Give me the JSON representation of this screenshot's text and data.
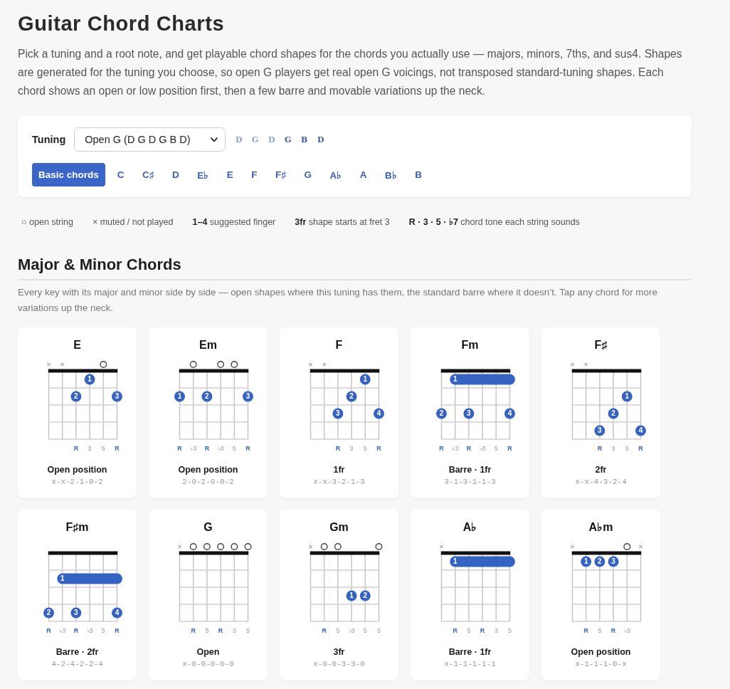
{
  "title": "Guitar Chord Charts",
  "intro": "Pick a tuning and a root note, and get playable chord shapes for the chords you actually use — majors, minors, 7ths, and sus4. Shapes are generated for the tuning you choose, so open G players get real open G voicings, not transposed standard-tuning shapes. Each chord shows an open or low position first, then a few barre and movable variations up the neck.",
  "controls": {
    "tuning": {
      "label": "Tuning",
      "value": "Open G (D G D G B D)",
      "strings": [
        {
          "note": "D",
          "color": "#8ea3cc"
        },
        {
          "note": "G",
          "color": "#8ea3cc"
        },
        {
          "note": "D",
          "color": "#8ea3cc"
        },
        {
          "note": "G",
          "color": "#3b5aa6"
        },
        {
          "note": "B",
          "color": "#3b5aa6"
        },
        {
          "note": "D",
          "color": "#3b5aa6"
        }
      ]
    },
    "keys": [
      {
        "label": "Basic chords",
        "selected": true
      },
      {
        "label": "C",
        "selected": false
      },
      {
        "label": "C♯",
        "selected": false
      },
      {
        "label": "D",
        "selected": false
      },
      {
        "label": "E♭",
        "selected": false
      },
      {
        "label": "E",
        "selected": false
      },
      {
        "label": "F",
        "selected": false
      },
      {
        "label": "F♯",
        "selected": false
      },
      {
        "label": "G",
        "selected": false
      },
      {
        "label": "A♭",
        "selected": false
      },
      {
        "label": "A",
        "selected": false
      },
      {
        "label": "B♭",
        "selected": false
      },
      {
        "label": "B",
        "selected": false
      }
    ]
  },
  "legend": [
    "○ open string",
    "× muted / not played",
    "**1–4** suggested finger",
    "**3fr** shape starts at fret 3",
    "**R · 3 · 5 · ♭7** chord tone each string sounds"
  ],
  "section": {
    "title": "Major & Minor Chords",
    "description": "Every key with its major and minor side by side — open shapes where this tuning has them, the standard barre where it doesn’t. Tap any chord for more variations up the neck."
  },
  "chords": [
    {
      "name": "E",
      "strings": [
        {
          "kind": "muted"
        },
        {
          "kind": "muted"
        },
        {
          "kind": "fretted",
          "tone": "R",
          "root": true
        },
        {
          "kind": "fretted",
          "tone": "3",
          "root": false
        },
        {
          "kind": "open",
          "tone": "5",
          "root": false
        },
        {
          "kind": "fretted",
          "tone": "R",
          "root": true
        }
      ],
      "frets": [
        {
          "cells": [
            {
              "kind": "empty"
            },
            {
              "kind": "empty"
            },
            {
              "kind": "empty"
            },
            {
              "kind": "dot",
              "finger": "1"
            },
            {
              "kind": "empty"
            },
            {
              "kind": "empty"
            }
          ]
        },
        {
          "cells": [
            {
              "kind": "empty"
            },
            {
              "kind": "empty"
            },
            {
              "kind": "dot",
              "finger": "2"
            },
            {
              "kind": "empty"
            },
            {
              "kind": "empty"
            },
            {
              "kind": "dot",
              "finger": "3"
            }
          ]
        },
        {
          "cells": [
            {
              "kind": "empty"
            },
            {
              "kind": "empty"
            },
            {
              "kind": "empty"
            },
            {
              "kind": "empty"
            },
            {
              "kind": "empty"
            },
            {
              "kind": "empty"
            }
          ]
        },
        {
          "cells": [
            {
              "kind": "empty"
            },
            {
              "kind": "empty"
            },
            {
              "kind": "empty"
            },
            {
              "kind": "empty"
            },
            {
              "kind": "empty"
            },
            {
              "kind": "empty"
            }
          ]
        }
      ],
      "position": "Open position",
      "fingering": "x-x-2-1-0-2"
    },
    {
      "name": "Em",
      "strings": [
        {
          "kind": "fretted",
          "tone": "R",
          "root": true
        },
        {
          "kind": "open",
          "tone": "♭3",
          "root": false
        },
        {
          "kind": "fretted",
          "tone": "R",
          "root": true
        },
        {
          "kind": "open",
          "tone": "♭3",
          "root": false
        },
        {
          "kind": "open",
          "tone": "5",
          "root": false
        },
        {
          "kind": "fretted",
          "tone": "R",
          "root": true
        }
      ],
      "frets": [
        {
          "cells": [
            {
              "kind": "empty"
            },
            {
              "kind": "empty"
            },
            {
              "kind": "empty"
            },
            {
              "kind": "empty"
            },
            {
              "kind": "empty"
            },
            {
              "kind": "empty"
            }
          ]
        },
        {
          "cells": [
            {
              "kind": "dot",
              "finger": "1"
            },
            {
              "kind": "empty"
            },
            {
              "kind": "dot",
              "finger": "2"
            },
            {
              "kind": "empty"
            },
            {
              "kind": "empty"
            },
            {
              "kind": "dot",
              "finger": "3"
            }
          ]
        },
        {
          "cells": [
            {
              "kind": "empty"
            },
            {
              "kind": "empty"
            },
            {
              "kind": "empty"
            },
            {
              "kind": "empty"
            },
            {
              "kind": "empty"
            },
            {
              "kind": "empty"
            }
          ]
        },
        {
          "cells": [
            {
              "kind": "empty"
            },
            {
              "kind": "empty"
            },
            {
              "kind": "empty"
            },
            {
              "kind": "empty"
            },
            {
              "kind": "empty"
            },
            {
              "kind": "empty"
            }
          ]
        }
      ],
      "position": "Open position",
      "fingering": "2-0-2-0-0-2"
    },
    {
      "name": "F",
      "strings": [
        {
          "kind": "muted"
        },
        {
          "kind": "muted"
        },
        {
          "kind": "fretted",
          "tone": "R",
          "root": true
        },
        {
          "kind": "fretted",
          "tone": "3",
          "root": false
        },
        {
          "kind": "fretted",
          "tone": "5",
          "root": false
        },
        {
          "kind": "fretted",
          "tone": "R",
          "root": true
        }
      ],
      "frets": [
        {
          "cells": [
            {
              "kind": "empty"
            },
            {
              "kind": "empty"
            },
            {
              "kind": "empty"
            },
            {
              "kind": "empty"
            },
            {
              "kind": "dot",
              "finger": "1"
            },
            {
              "kind": "empty"
            }
          ]
        },
        {
          "cells": [
            {
              "kind": "empty"
            },
            {
              "kind": "empty"
            },
            {
              "kind": "empty"
            },
            {
              "kind": "dot",
              "finger": "2"
            },
            {
              "kind": "empty"
            },
            {
              "kind": "empty"
            }
          ]
        },
        {
          "cells": [
            {
              "kind": "empty"
            },
            {
              "kind": "empty"
            },
            {
              "kind": "dot",
              "finger": "3"
            },
            {
              "kind": "empty"
            },
            {
              "kind": "empty"
            },
            {
              "kind": "dot",
              "finger": "4"
            }
          ]
        },
        {
          "cells": [
            {
              "kind": "empty"
            },
            {
              "kind": "empty"
            },
            {
              "kind": "empty"
            },
            {
              "kind": "empty"
            },
            {
              "kind": "empty"
            },
            {
              "kind": "empty"
            }
          ]
        }
      ],
      "position": "1fr",
      "fingering": "x-x-3-2-1-3"
    },
    {
      "name": "Fm",
      "strings": [
        {
          "kind": "fretted",
          "tone": "R",
          "root": true
        },
        {
          "kind": "fretted",
          "tone": "♭3",
          "root": false
        },
        {
          "kind": "fretted",
          "tone": "R",
          "root": true
        },
        {
          "kind": "fretted",
          "tone": "♭3",
          "root": false
        },
        {
          "kind": "fretted",
          "tone": "5",
          "root": false
        },
        {
          "kind": "fretted",
          "tone": "R",
          "root": true
        }
      ],
      "frets": [
        {
          "cells": [
            {
              "kind": "empty"
            },
            {
              "kind": "barre",
              "finger": "1"
            },
            {
              "kind": "barre"
            },
            {
              "kind": "barre"
            },
            {
              "kind": "barre"
            },
            {
              "kind": "barre"
            }
          ]
        },
        {
          "cells": [
            {
              "kind": "empty"
            },
            {
              "kind": "empty"
            },
            {
              "kind": "empty"
            },
            {
              "kind": "empty"
            },
            {
              "kind": "empty"
            },
            {
              "kind": "empty"
            }
          ]
        },
        {
          "cells": [
            {
              "kind": "dot",
              "finger": "2"
            },
            {
              "kind": "empty"
            },
            {
              "kind": "dot",
              "finger": "3"
            },
            {
              "kind": "empty"
            },
            {
              "kind": "empty"
            },
            {
              "kind": "dot",
              "finger": "4"
            }
          ]
        },
        {
          "cells": [
            {
              "kind": "empty"
            },
            {
              "kind": "empty"
            },
            {
              "kind": "empty"
            },
            {
              "kind": "empty"
            },
            {
              "kind": "empty"
            },
            {
              "kind": "empty"
            }
          ]
        }
      ],
      "position": "Barre · 1fr",
      "fingering": "3-1-3-1-1-3"
    },
    {
      "name": "F♯",
      "strings": [
        {
          "kind": "muted"
        },
        {
          "kind": "muted"
        },
        {
          "kind": "fretted",
          "tone": "R",
          "root": true
        },
        {
          "kind": "fretted",
          "tone": "3",
          "root": false
        },
        {
          "kind": "fretted",
          "tone": "5",
          "root": false
        },
        {
          "kind": "fretted",
          "tone": "R",
          "root": true
        }
      ],
      "frets": [
        {
          "cells": [
            {
              "kind": "empty"
            },
            {
              "kind": "empty"
            },
            {
              "kind": "empty"
            },
            {
              "kind": "empty"
            },
            {
              "kind": "empty"
            },
            {
              "kind": "empty"
            }
          ]
        },
        {
          "cells": [
            {
              "kind": "empty"
            },
            {
              "kind": "empty"
            },
            {
              "kind": "empty"
            },
            {
              "kind": "empty"
            },
            {
              "kind": "dot",
              "finger": "1"
            },
            {
              "kind": "empty"
            }
          ]
        },
        {
          "cells": [
            {
              "kind": "empty"
            },
            {
              "kind": "empty"
            },
            {
              "kind": "empty"
            },
            {
              "kind": "dot",
              "finger": "2"
            },
            {
              "kind": "empty"
            },
            {
              "kind": "empty"
            }
          ]
        },
        {
          "cells": [
            {
              "kind": "empty"
            },
            {
              "kind": "empty"
            },
            {
              "kind": "dot",
              "finger": "3"
            },
            {
              "kind": "empty"
            },
            {
              "kind": "empty"
            },
            {
              "kind": "dot",
              "finger": "4"
            }
          ]
        }
      ],
      "position": "2fr",
      "fingering": "x-x-4-3-2-4"
    },
    {
      "name": "F♯m",
      "strings": [
        {
          "kind": "fretted",
          "tone": "R",
          "root": true
        },
        {
          "kind": "fretted",
          "tone": "♭3",
          "root": false
        },
        {
          "kind": "fretted",
          "tone": "R",
          "root": true
        },
        {
          "kind": "fretted",
          "tone": "♭3",
          "root": false
        },
        {
          "kind": "fretted",
          "tone": "5",
          "root": false
        },
        {
          "kind": "fretted",
          "tone": "R",
          "root": true
        }
      ],
      "frets": [
        {
          "cells": [
            {
              "kind": "empty"
            },
            {
              "kind": "empty"
            },
            {
              "kind": "empty"
            },
            {
              "kind": "empty"
            },
            {
              "kind": "empty"
            },
            {
              "kind": "empty"
            }
          ]
        },
        {
          "cells": [
            {
              "kind": "empty"
            },
            {
              "kind": "barre",
              "finger": "1"
            },
            {
              "kind": "barre"
            },
            {
              "kind": "barre"
            },
            {
              "kind": "barre"
            },
            {
              "kind": "barre"
            }
          ]
        },
        {
          "cells": [
            {
              "kind": "empty"
            },
            {
              "kind": "empty"
            },
            {
              "kind": "empty"
            },
            {
              "kind": "empty"
            },
            {
              "kind": "empty"
            },
            {
              "kind": "empty"
            }
          ]
        },
        {
          "cells": [
            {
              "kind": "dot",
              "finger": "2"
            },
            {
              "kind": "empty"
            },
            {
              "kind": "dot",
              "finger": "3"
            },
            {
              "kind": "empty"
            },
            {
              "kind": "empty"
            },
            {
              "kind": "dot",
              "finger": "4"
            }
          ]
        }
      ],
      "position": "Barre · 2fr",
      "fingering": "4-2-4-2-2-4"
    },
    {
      "name": "G",
      "strings": [
        {
          "kind": "muted"
        },
        {
          "kind": "open",
          "tone": "R",
          "root": true
        },
        {
          "kind": "open",
          "tone": "5",
          "root": false
        },
        {
          "kind": "open",
          "tone": "R",
          "root": true
        },
        {
          "kind": "open",
          "tone": "3",
          "root": false
        },
        {
          "kind": "open",
          "tone": "5",
          "root": false
        }
      ],
      "frets": [
        {
          "cells": [
            {
              "kind": "empty"
            },
            {
              "kind": "empty"
            },
            {
              "kind": "empty"
            },
            {
              "kind": "empty"
            },
            {
              "kind": "empty"
            },
            {
              "kind": "empty"
            }
          ]
        },
        {
          "cells": [
            {
              "kind": "empty"
            },
            {
              "kind": "empty"
            },
            {
              "kind": "empty"
            },
            {
              "kind": "empty"
            },
            {
              "kind": "empty"
            },
            {
              "kind": "empty"
            }
          ]
        },
        {
          "cells": [
            {
              "kind": "empty"
            },
            {
              "kind": "empty"
            },
            {
              "kind": "empty"
            },
            {
              "kind": "empty"
            },
            {
              "kind": "empty"
            },
            {
              "kind": "empty"
            }
          ]
        },
        {
          "cells": [
            {
              "kind": "empty"
            },
            {
              "kind": "empty"
            },
            {
              "kind": "empty"
            },
            {
              "kind": "empty"
            },
            {
              "kind": "empty"
            },
            {
              "kind": "empty"
            }
          ]
        }
      ],
      "position": "Open",
      "fingering": "x-0-0-0-0-0"
    },
    {
      "name": "Gm",
      "strings": [
        {
          "kind": "muted"
        },
        {
          "kind": "open",
          "tone": "R",
          "root": true
        },
        {
          "kind": "open",
          "tone": "5",
          "root": false
        },
        {
          "kind": "fretted",
          "tone": "♭3",
          "root": false
        },
        {
          "kind": "fretted",
          "tone": "5",
          "root": false
        },
        {
          "kind": "open",
          "tone": "5",
          "root": false
        }
      ],
      "frets": [
        {
          "cells": [
            {
              "kind": "empty"
            },
            {
              "kind": "empty"
            },
            {
              "kind": "empty"
            },
            {
              "kind": "empty"
            },
            {
              "kind": "empty"
            },
            {
              "kind": "empty"
            }
          ]
        },
        {
          "cells": [
            {
              "kind": "empty"
            },
            {
              "kind": "empty"
            },
            {
              "kind": "empty"
            },
            {
              "kind": "empty"
            },
            {
              "kind": "empty"
            },
            {
              "kind": "empty"
            }
          ]
        },
        {
          "cells": [
            {
              "kind": "empty"
            },
            {
              "kind": "empty"
            },
            {
              "kind": "empty"
            },
            {
              "kind": "dot",
              "finger": "1"
            },
            {
              "kind": "dot",
              "finger": "2"
            },
            {
              "kind": "empty"
            }
          ]
        },
        {
          "cells": [
            {
              "kind": "empty"
            },
            {
              "kind": "empty"
            },
            {
              "kind": "empty"
            },
            {
              "kind": "empty"
            },
            {
              "kind": "empty"
            },
            {
              "kind": "empty"
            }
          ]
        }
      ],
      "position": "3fr",
      "fingering": "x-0-0-3-3-0"
    },
    {
      "name": "A♭",
      "strings": [
        {
          "kind": "muted"
        },
        {
          "kind": "fretted",
          "tone": "R",
          "root": true
        },
        {
          "kind": "fretted",
          "tone": "5",
          "root": false
        },
        {
          "kind": "fretted",
          "tone": "R",
          "root": true
        },
        {
          "kind": "fretted",
          "tone": "3",
          "root": false
        },
        {
          "kind": "fretted",
          "tone": "5",
          "root": false
        }
      ],
      "frets": [
        {
          "cells": [
            {
              "kind": "empty"
            },
            {
              "kind": "barre",
              "finger": "1"
            },
            {
              "kind": "barre"
            },
            {
              "kind": "barre"
            },
            {
              "kind": "barre"
            },
            {
              "kind": "barre"
            }
          ]
        },
        {
          "cells": [
            {
              "kind": "empty"
            },
            {
              "kind": "empty"
            },
            {
              "kind": "empty"
            },
            {
              "kind": "empty"
            },
            {
              "kind": "empty"
            },
            {
              "kind": "empty"
            }
          ]
        },
        {
          "cells": [
            {
              "kind": "empty"
            },
            {
              "kind": "empty"
            },
            {
              "kind": "empty"
            },
            {
              "kind": "empty"
            },
            {
              "kind": "empty"
            },
            {
              "kind": "empty"
            }
          ]
        },
        {
          "cells": [
            {
              "kind": "empty"
            },
            {
              "kind": "empty"
            },
            {
              "kind": "empty"
            },
            {
              "kind": "empty"
            },
            {
              "kind": "empty"
            },
            {
              "kind": "empty"
            }
          ]
        }
      ],
      "position": "Barre · 1fr",
      "fingering": "x-1-1-1-1-1"
    },
    {
      "name": "A♭m",
      "strings": [
        {
          "kind": "muted"
        },
        {
          "kind": "fretted",
          "tone": "R",
          "root": true
        },
        {
          "kind": "fretted",
          "tone": "5",
          "root": false
        },
        {
          "kind": "fretted",
          "tone": "R",
          "root": true
        },
        {
          "kind": "open",
          "tone": "♭3",
          "root": false
        },
        {
          "kind": "muted"
        }
      ],
      "frets": [
        {
          "cells": [
            {
              "kind": "empty"
            },
            {
              "kind": "dot",
              "finger": "1"
            },
            {
              "kind": "dot",
              "finger": "2"
            },
            {
              "kind": "dot",
              "finger": "3"
            },
            {
              "kind": "empty"
            },
            {
              "kind": "empty"
            }
          ]
        },
        {
          "cells": [
            {
              "kind": "empty"
            },
            {
              "kind": "empty"
            },
            {
              "kind": "empty"
            },
            {
              "kind": "empty"
            },
            {
              "kind": "empty"
            },
            {
              "kind": "empty"
            }
          ]
        },
        {
          "cells": [
            {
              "kind": "empty"
            },
            {
              "kind": "empty"
            },
            {
              "kind": "empty"
            },
            {
              "kind": "empty"
            },
            {
              "kind": "empty"
            },
            {
              "kind": "empty"
            }
          ]
        },
        {
          "cells": [
            {
              "kind": "empty"
            },
            {
              "kind": "empty"
            },
            {
              "kind": "empty"
            },
            {
              "kind": "empty"
            },
            {
              "kind": "empty"
            },
            {
              "kind": "empty"
            }
          ]
        }
      ],
      "position": "Open position",
      "fingering": "x-1-1-1-0-x"
    }
  ]
}
